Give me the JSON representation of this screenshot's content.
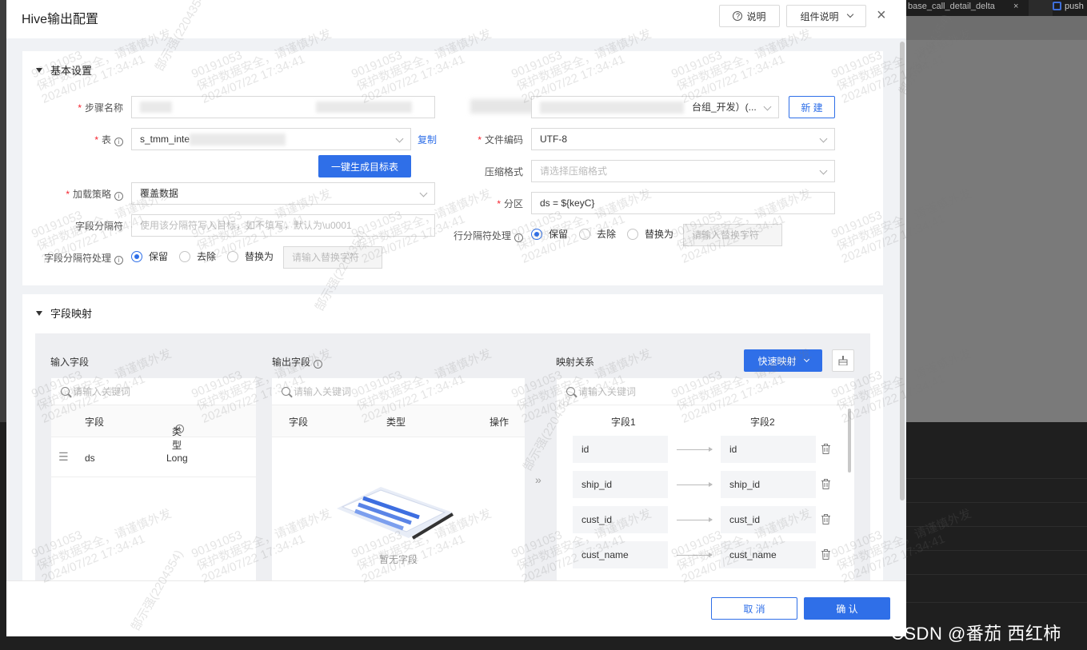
{
  "background": {
    "tab_label": "base_call_detail_delta",
    "tab_close": "×",
    "tab2_label": "push"
  },
  "watermark": "CSDN @番茄 西红柿",
  "modal": {
    "title": "Hive输出配置",
    "help_label": "说明",
    "component_help_label": "组件说明",
    "close_glyph": "×",
    "basic": {
      "section_title": "基本设置",
      "step_name_label": "步骤名称",
      "table_label": "表",
      "table_value": "s_tmm_inte",
      "copy_link": "复制",
      "generate_button": "一键生成目标表",
      "load_strategy_label": "加载策略",
      "load_strategy_value": "覆盖数据",
      "field_sep_label": "字段分隔符",
      "field_sep_placeholder": "使用该分隔符写入目标，如不填写，默认为\\u0001",
      "field_sep_handle_label": "字段分隔符处理",
      "datasource_value": "台组_开发）(...",
      "new_button": "新 建",
      "encoding_label": "文件编码",
      "encoding_value": "UTF-8",
      "compression_label": "压缩格式",
      "compression_placeholder": "请选择压缩格式",
      "partition_label": "分区",
      "partition_value": "ds = ${keyC}",
      "row_sep_handle_label": "行分隔符处理",
      "radio_options": [
        "保留",
        "去除",
        "替换为"
      ],
      "replace_placeholder": "请输入替换字符"
    },
    "mapping": {
      "section_title": "字段映射",
      "input_title": "输入字段",
      "output_title": "输出字段",
      "relation_title": "映射关系",
      "quick_map_button": "快速映射",
      "search_placeholder": "请输入关键词",
      "input_headers": [
        "字段",
        "类型"
      ],
      "input_rows": [
        {
          "field": "ds",
          "type": "Long"
        }
      ],
      "output_headers": [
        "字段",
        "类型",
        "操作"
      ],
      "output_empty": "暂无字段",
      "relation_headers": [
        "字段1",
        "字段2"
      ],
      "relations": [
        {
          "from": "id",
          "to": "id"
        },
        {
          "from": "ship_id",
          "to": "ship_id"
        },
        {
          "from": "cust_id",
          "to": "cust_id"
        },
        {
          "from": "cust_name",
          "to": "cust_name"
        }
      ]
    },
    "footer": {
      "cancel": "取 消",
      "confirm": "确 认"
    }
  },
  "overlay_watermark": {
    "id": "90191053",
    "text": "保护数据安全，请谨慎外发",
    "time": "2024/07/22 17:34:41",
    "user": "郜示强(2204354)"
  },
  "colors": {
    "primary": "#2f6fe8",
    "required": "#f5222d"
  }
}
